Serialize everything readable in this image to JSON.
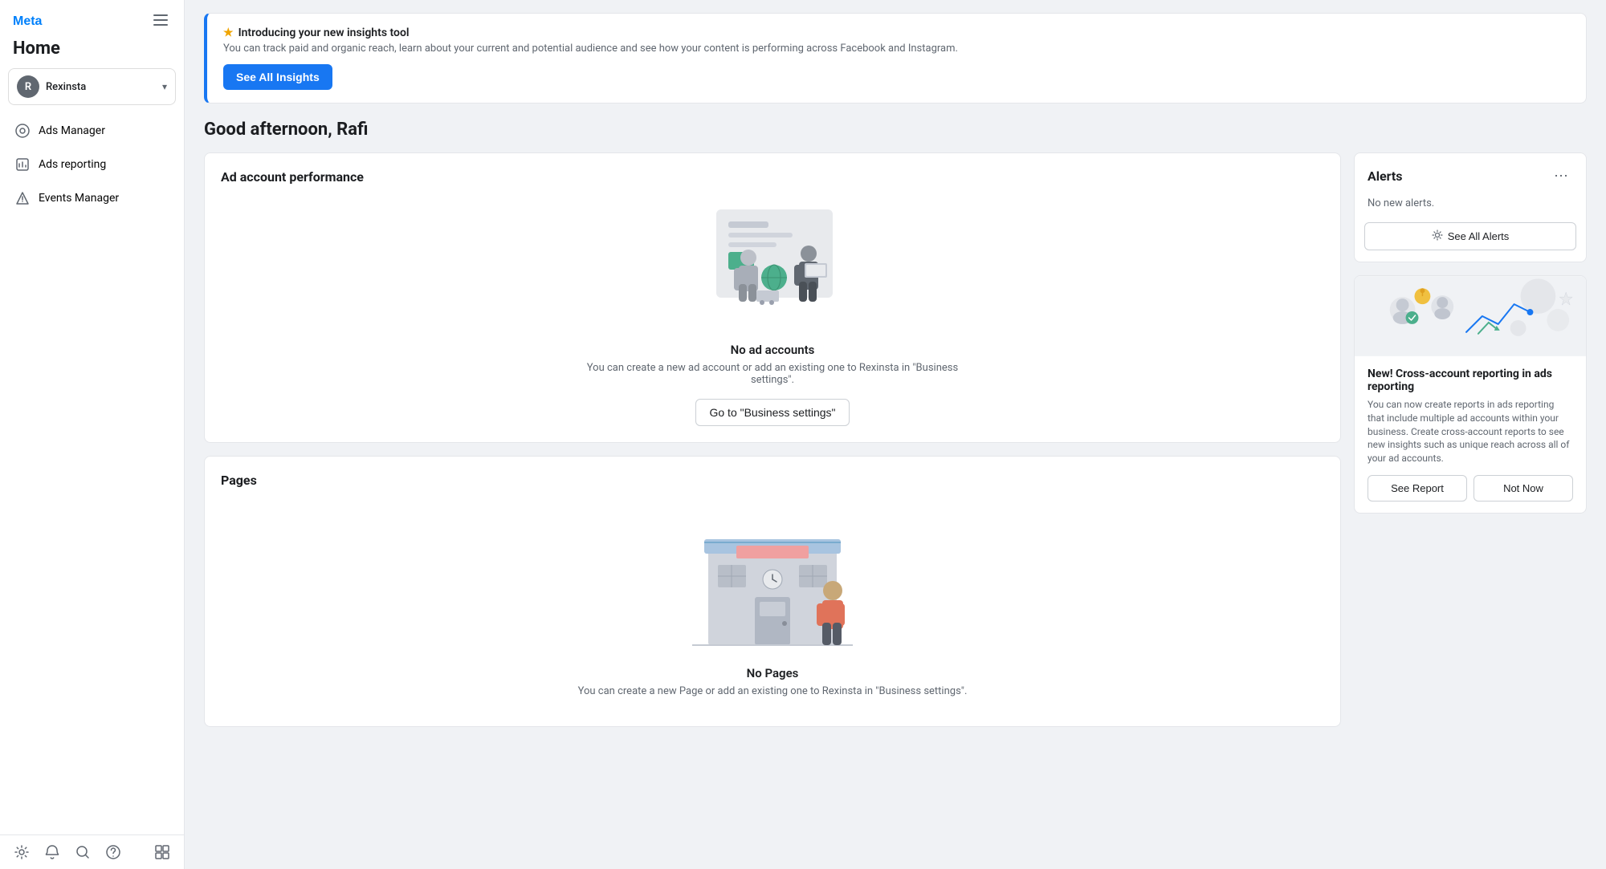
{
  "app": {
    "logo_text": "Meta",
    "home_title": "Home"
  },
  "sidebar": {
    "account": {
      "initial": "R",
      "name": "Rexinsta"
    },
    "nav_items": [
      {
        "id": "ads-manager",
        "label": "Ads Manager",
        "icon": "ads-manager-icon"
      },
      {
        "id": "ads-reporting",
        "label": "Ads reporting",
        "icon": "ads-reporting-icon"
      },
      {
        "id": "events-manager",
        "label": "Events Manager",
        "icon": "events-manager-icon"
      }
    ],
    "footer_icons": [
      "settings-icon",
      "bell-icon",
      "search-icon",
      "help-icon",
      "grid-icon"
    ]
  },
  "insights_banner": {
    "title": "Introducing your new insights tool",
    "description": "You can track paid and organic reach, learn about your current and potential audience and see how your content is performing across Facebook and Instagram.",
    "cta_label": "See All Insights",
    "star_icon": "★"
  },
  "greeting": "Good afternoon, Rafi",
  "ad_account_performance": {
    "title": "Ad account performance",
    "no_data_title": "No ad accounts",
    "no_data_desc": "You can create a new ad account or add an existing one to Rexinsta in \"Business settings\".",
    "cta_label": "Go to \"Business settings\""
  },
  "pages": {
    "title": "Pages",
    "no_data_title": "No Pages",
    "no_data_desc": "You can create a new Page or add an existing one to Rexinsta in \"Business settings\"."
  },
  "alerts": {
    "title": "Alerts",
    "no_alerts_text": "No new alerts.",
    "see_all_label": "See All Alerts",
    "more_icon": "⋯"
  },
  "cross_account": {
    "badge": "New! Cross-account reporting in ads reporting",
    "description": "You can now create reports in ads reporting that include multiple ad accounts within your business. Create cross-account reports to see new insights such as unique reach across all of your ad accounts.",
    "see_report_label": "See Report",
    "not_now_label": "Not Now"
  }
}
